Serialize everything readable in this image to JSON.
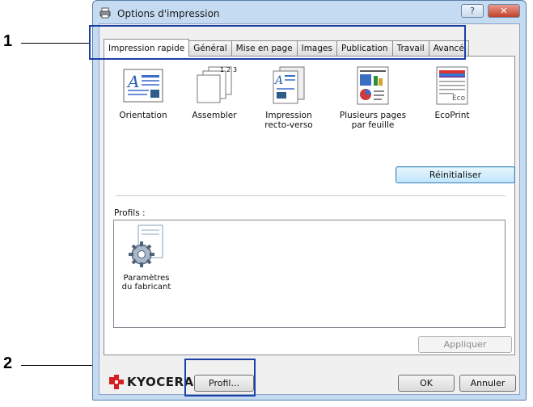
{
  "window": {
    "title": "Options d'impression",
    "help_label": "?",
    "close_label": "✕"
  },
  "tabs": [
    {
      "label": "Impression rapide",
      "active": true
    },
    {
      "label": "Général"
    },
    {
      "label": "Mise en page"
    },
    {
      "label": "Images"
    },
    {
      "label": "Publication"
    },
    {
      "label": "Travail"
    },
    {
      "label": "Avancé"
    }
  ],
  "quick_functions": [
    {
      "label_line1": "Orientation",
      "label_line2": "",
      "icon": "orientation-icon"
    },
    {
      "label_line1": "Assembler",
      "label_line2": "",
      "icon": "collate-icon"
    },
    {
      "label_line1": "Impression",
      "label_line2": "recto-verso",
      "icon": "duplex-icon"
    },
    {
      "label_line1": "Plusieurs pages",
      "label_line2": "par feuille",
      "icon": "multi-page-icon"
    },
    {
      "label_line1": "EcoPrint",
      "label_line2": "",
      "icon": "ecoprint-icon",
      "icon_text": "Eco"
    }
  ],
  "collate_digits": [
    "1",
    "2",
    "3"
  ],
  "reset_label": "Réinitialiser",
  "profiles": {
    "label": "Profils :",
    "items": [
      {
        "label_line1": "Paramètres",
        "label_line2": "du fabricant",
        "icon": "gear-document-icon"
      }
    ]
  },
  "apply_label": "Appliquer",
  "footer": {
    "brand": "KYOCERA",
    "profile_label": "Profil...",
    "ok_label": "OK",
    "cancel_label": "Annuler"
  },
  "callouts": {
    "one": "1",
    "two": "2"
  },
  "colors": {
    "highlight": "#1c3fa8",
    "brand": "#d42020",
    "window_frame": "#c4dbf1"
  }
}
